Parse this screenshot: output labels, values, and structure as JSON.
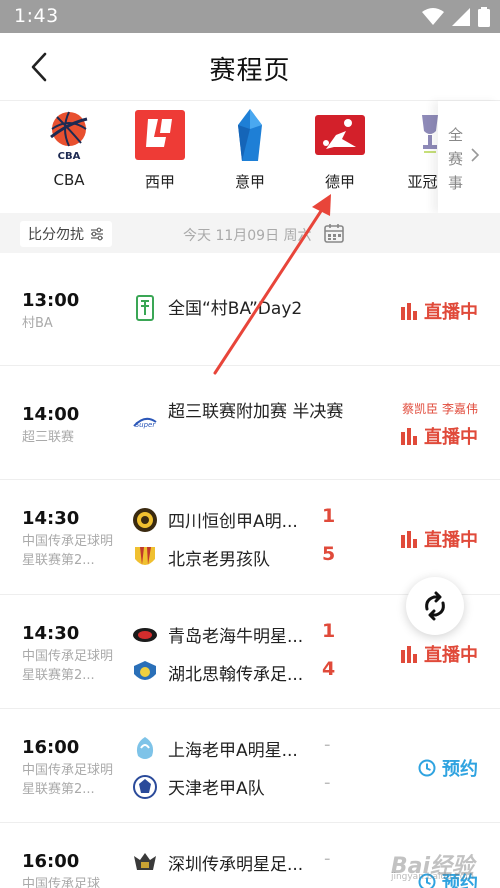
{
  "status_bar": {
    "time": "1:43"
  },
  "nav": {
    "title": "赛程页"
  },
  "leagues": [
    {
      "name": "CBA",
      "icon": "cba-logo-icon"
    },
    {
      "name": "西甲",
      "icon": "laliga-logo-icon"
    },
    {
      "name": "意甲",
      "icon": "serie-a-logo-icon"
    },
    {
      "name": "德甲",
      "icon": "bundesliga-logo-icon"
    },
    {
      "name": "亚冠精",
      "icon": "afc-trophy-icon"
    }
  ],
  "all_events": {
    "label": "全赛事"
  },
  "filter": {
    "chip_label": "比分勿扰",
    "date_text": "今天 11月09日 周六"
  },
  "matches": [
    {
      "time": "13:00",
      "league": "村BA",
      "title": "全国“村BA”Day2",
      "status": "直播中"
    },
    {
      "time": "14:00",
      "league": "超三联赛",
      "title": "超三联赛附加赛 半决赛",
      "commentators": "蔡凯臣 李嘉伟",
      "status": "直播中"
    },
    {
      "time": "14:30",
      "league": "中国传承足球明星联赛第2...",
      "home": "四川恒创甲A明...",
      "home_score": "1",
      "away": "北京老男孩队",
      "away_score": "5",
      "status": "直播中"
    },
    {
      "time": "14:30",
      "league": "中国传承足球明星联赛第2...",
      "home": "青岛老海牛明星...",
      "home_score": "1",
      "away": "湖北思翰传承足...",
      "away_score": "4",
      "status": "直播中"
    },
    {
      "time": "16:00",
      "league": "中国传承足球明星联赛第2...",
      "home": "上海老甲A明星...",
      "home_score": "-",
      "away": "天津老甲A队",
      "away_score": "-",
      "status": "预约"
    },
    {
      "time": "16:00",
      "league": "中国传承足球",
      "home": "深圳传承明星足...",
      "home_score": "-",
      "status": "预约"
    }
  ],
  "watermark": {
    "text": "Bai经验",
    "sub": "jingyan.baidu.com"
  },
  "colors": {
    "live": "#e04a3a",
    "reserve": "#2fa3e0",
    "status_bar": "#9e9e9e"
  }
}
